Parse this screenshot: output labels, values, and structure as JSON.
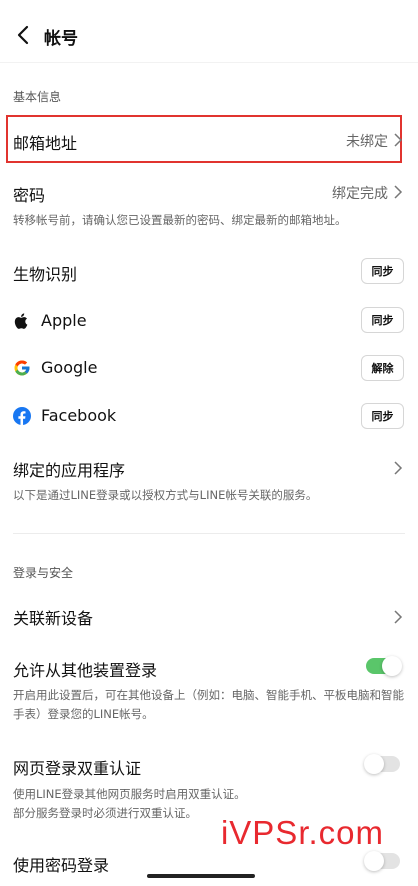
{
  "header": {
    "title": "帐号"
  },
  "sections": {
    "basic_info": "基本信息",
    "login_security": "登录与安全"
  },
  "email_row": {
    "label": "邮箱地址",
    "value": "未绑定"
  },
  "password_row": {
    "label": "密码",
    "value": "绑定完成",
    "note": "转移帐号前，请确认您已设置最新的密码、绑定最新的邮箱地址。"
  },
  "biometric_row": {
    "label": "生物识别",
    "button": "同步"
  },
  "apple_row": {
    "label": "Apple",
    "button": "同步",
    "icon": "apple-icon"
  },
  "google_row": {
    "label": "Google",
    "button": "解除",
    "icon": "google-icon"
  },
  "facebook_row": {
    "label": "Facebook",
    "button": "同步",
    "icon": "facebook-icon"
  },
  "linked_apps_row": {
    "label": "绑定的应用程序",
    "note": "以下是通过LINE登录或以授权方式与LINE帐号关联的服务。"
  },
  "link_device_row": {
    "label": "关联新设备"
  },
  "allow_login_row": {
    "label": "允许从其他装置登录",
    "toggle_on": true,
    "note": "开启用此设置后，可在其他设备上（例如：电脑、智能手机、平板电脑和智能手表）登录您的LINE帐号。"
  },
  "web_2fa_row": {
    "label": "网页登录双重认证",
    "toggle_on": false,
    "note_line1": "使用LINE登录其他网页服务时启用双重认证。",
    "note_line2": "部分服务登录时必须进行双重认证。"
  },
  "password_login_row": {
    "label": "使用密码登录",
    "toggle_on": false
  },
  "watermark": "iVPSr.com",
  "colors": {
    "highlight": "#e1342f",
    "toggle_on": "#5ac66a",
    "toggle_off": "#e3e3e3",
    "facebook": "#1877f2",
    "watermark": "#e8292f"
  }
}
